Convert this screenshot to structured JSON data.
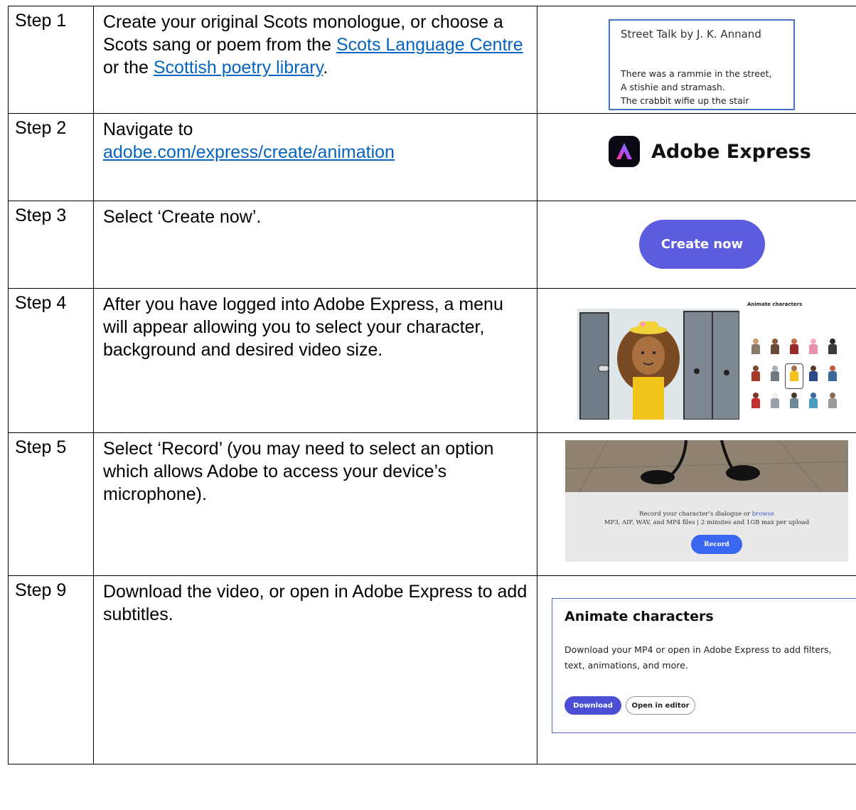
{
  "rows": [
    {
      "step": "Step 1",
      "parts": {
        "t1": "Create your original Scots monologue, or choose a Scots sang or poem from the ",
        "link1": "Scots Language Centre",
        "t2": " or the ",
        "link2": "Scottish poetry library",
        "t3": "."
      },
      "image": {
        "title": "Street Talk by J. K. Annand",
        "lines": [
          "There was a rammie in the street,",
          "A stishie and stramash.",
          "The crabbit wifie up the stair"
        ]
      }
    },
    {
      "step": "Step 2",
      "parts": {
        "t1": "Navigate to ",
        "link1": "adobe.com/express/create/animation"
      },
      "image": {
        "brand": "Adobe Express",
        "icon": "adobe-express-logo-icon"
      }
    },
    {
      "step": "Step 3",
      "text": "Select ‘Create now’.",
      "image": {
        "button": "Create now",
        "color": "#5c5ce0"
      }
    },
    {
      "step": "Step 4",
      "text": "After you have logged into Adobe Express, a menu will appear allowing you to select your character, background and desired video size.",
      "image": {
        "panel_title": "Animate characters"
      }
    },
    {
      "step": "Step 5",
      "text": "Select ‘Record’ (you may need to select an option which allows Adobe to access your device’s microphone).",
      "image": {
        "line1": "Record your character’s dialogue or ",
        "browse": "browse",
        "line2": "MP3, AIF, WAV, and MP4 files | 2 minutes and 1GB max per upload",
        "button": "Record"
      }
    },
    {
      "step": "Step 9",
      "text": "Download the video, or open in Adobe Express to add subtitles.",
      "image": {
        "title": "Animate characters",
        "desc": "Download your MP4 or open in Adobe Express to add filters, text, animations, and more.",
        "btn_download": "Download",
        "btn_editor": "Open in editor"
      }
    }
  ]
}
